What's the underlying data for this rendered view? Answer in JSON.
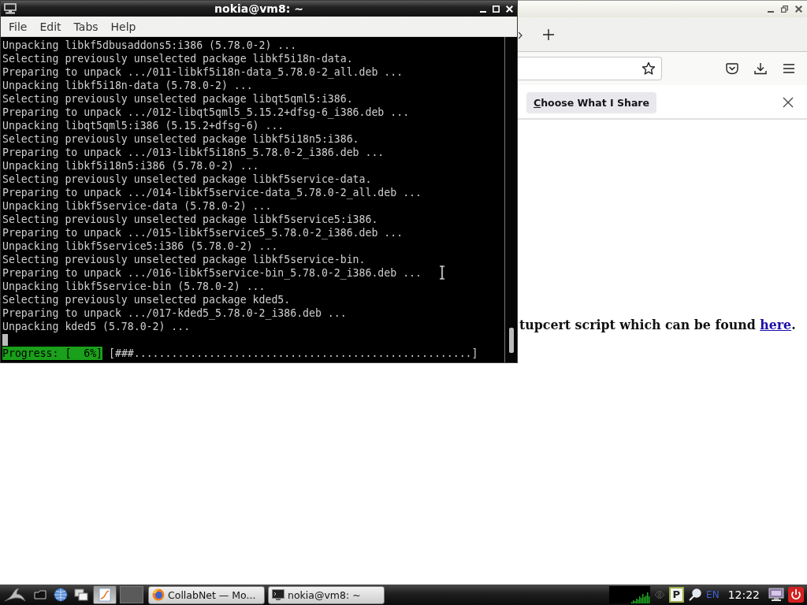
{
  "terminal": {
    "title": "nokia@vm8: ~",
    "menu": [
      "File",
      "Edit",
      "Tabs",
      "Help"
    ],
    "lines": [
      "Unpacking libkf5dbusaddons5:i386 (5.78.0-2) ...",
      "Selecting previously unselected package libkf5i18n-data.",
      "Preparing to unpack .../011-libkf5i18n-data_5.78.0-2_all.deb ...",
      "Unpacking libkf5i18n-data (5.78.0-2) ...",
      "Selecting previously unselected package libqt5qml5:i386.",
      "Preparing to unpack .../012-libqt5qml5_5.15.2+dfsg-6_i386.deb ...",
      "Unpacking libqt5qml5:i386 (5.15.2+dfsg-6) ...",
      "Selecting previously unselected package libkf5i18n5:i386.",
      "Preparing to unpack .../013-libkf5i18n5_5.78.0-2_i386.deb ...",
      "Unpacking libkf5i18n5:i386 (5.78.0-2) ...",
      "Selecting previously unselected package libkf5service-data.",
      "Preparing to unpack .../014-libkf5service-data_5.78.0-2_all.deb ...",
      "Unpacking libkf5service-data (5.78.0-2) ...",
      "Selecting previously unselected package libkf5service5:i386.",
      "Preparing to unpack .../015-libkf5service5_5.78.0-2_i386.deb ...",
      "Unpacking libkf5service5:i386 (5.78.0-2) ...",
      "Selecting previously unselected package libkf5service-bin.",
      "Preparing to unpack .../016-libkf5service-bin_5.78.0-2_i386.deb ...",
      "Unpacking libkf5service-bin (5.78.0-2) ...",
      "Selecting previously unselected package kded5.",
      "Preparing to unpack .../017-kded5_5.78.0-2_i386.deb ...",
      "Unpacking kded5 (5.78.0-2) ..."
    ],
    "progress": {
      "label": "Progress: [  6%]",
      "bar": "[###......................................................]"
    }
  },
  "browser": {
    "notification": {
      "button": "Choose What I Share"
    },
    "content": {
      "text": "tupcert script which can be found ",
      "link": "here",
      "after": "."
    }
  },
  "taskbar": {
    "tasks": [
      {
        "label": "CollabNet — Mo...",
        "kind": "browser"
      },
      {
        "label": "nokia@vm8: ~",
        "kind": "terminal"
      }
    ],
    "tray": {
      "clipboard": "P",
      "layout": "EN",
      "clock": "12:22"
    }
  }
}
